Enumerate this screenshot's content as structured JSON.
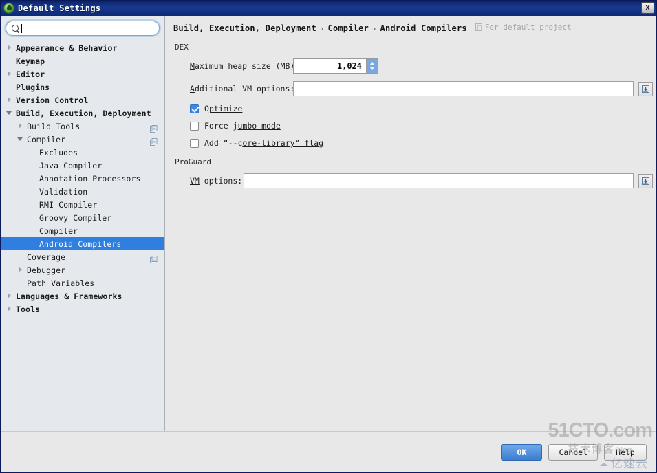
{
  "window": {
    "title": "Default Settings",
    "close_label": "x",
    "app_icon": "android-studio-icon"
  },
  "sidebar": {
    "search": {
      "value": "",
      "placeholder": "",
      "icon": "search-icon"
    },
    "items": [
      {
        "label": "Appearance & Behavior",
        "level": 0,
        "bold": true,
        "twisty": "right",
        "selected": false,
        "config_icon": false
      },
      {
        "label": "Keymap",
        "level": 0,
        "bold": true,
        "twisty": "none",
        "selected": false,
        "config_icon": false
      },
      {
        "label": "Editor",
        "level": 0,
        "bold": true,
        "twisty": "right",
        "selected": false,
        "config_icon": false
      },
      {
        "label": "Plugins",
        "level": 0,
        "bold": true,
        "twisty": "none",
        "selected": false,
        "config_icon": false
      },
      {
        "label": "Version Control",
        "level": 0,
        "bold": true,
        "twisty": "right",
        "selected": false,
        "config_icon": false
      },
      {
        "label": "Build, Execution, Deployment",
        "level": 0,
        "bold": true,
        "twisty": "down",
        "selected": false,
        "config_icon": false
      },
      {
        "label": "Build Tools",
        "level": 1,
        "bold": false,
        "twisty": "right",
        "selected": false,
        "config_icon": true
      },
      {
        "label": "Compiler",
        "level": 1,
        "bold": false,
        "twisty": "down",
        "selected": false,
        "config_icon": true
      },
      {
        "label": "Excludes",
        "level": 2,
        "bold": false,
        "twisty": "none",
        "selected": false,
        "config_icon": false
      },
      {
        "label": "Java Compiler",
        "level": 2,
        "bold": false,
        "twisty": "none",
        "selected": false,
        "config_icon": false
      },
      {
        "label": "Annotation Processors",
        "level": 2,
        "bold": false,
        "twisty": "none",
        "selected": false,
        "config_icon": false
      },
      {
        "label": "Validation",
        "level": 2,
        "bold": false,
        "twisty": "none",
        "selected": false,
        "config_icon": false
      },
      {
        "label": "RMI Compiler",
        "level": 2,
        "bold": false,
        "twisty": "none",
        "selected": false,
        "config_icon": false
      },
      {
        "label": "Groovy Compiler",
        "level": 2,
        "bold": false,
        "twisty": "none",
        "selected": false,
        "config_icon": false
      },
      {
        "label": "Compiler",
        "level": 2,
        "bold": false,
        "twisty": "none",
        "selected": false,
        "config_icon": false
      },
      {
        "label": "Android Compilers",
        "level": 2,
        "bold": false,
        "twisty": "none",
        "selected": true,
        "config_icon": false
      },
      {
        "label": "Coverage",
        "level": 1,
        "bold": false,
        "twisty": "none",
        "selected": false,
        "config_icon": true
      },
      {
        "label": "Debugger",
        "level": 1,
        "bold": false,
        "twisty": "right",
        "selected": false,
        "config_icon": false
      },
      {
        "label": "Path Variables",
        "level": 1,
        "bold": false,
        "twisty": "none",
        "selected": false,
        "config_icon": false
      },
      {
        "label": "Languages & Frameworks",
        "level": 0,
        "bold": true,
        "twisty": "right",
        "selected": false,
        "config_icon": false
      },
      {
        "label": "Tools",
        "level": 0,
        "bold": true,
        "twisty": "right",
        "selected": false,
        "config_icon": false
      }
    ]
  },
  "breadcrumb": {
    "crumbs": [
      "Build, Execution, Deployment",
      "Compiler",
      "Android Compilers"
    ],
    "separator": "›",
    "scope_label": "For default project",
    "scope_icon": "project-scope-icon"
  },
  "dex_section": {
    "title": "DEX",
    "heap_size": {
      "label_prefix": "M",
      "label_rest": "aximum heap size (MB):",
      "value": "1,024",
      "spinner_up_icon": "caret-up-icon",
      "spinner_down_icon": "caret-down-icon"
    },
    "vm_options": {
      "label_prefix": "A",
      "label_rest": "dditional VM options:",
      "value": "",
      "expand_icon": "expand-field-icon"
    },
    "checkboxes": [
      {
        "label_pre": "O",
        "label_post": "ptimize",
        "checked": true,
        "name": "optimize"
      },
      {
        "label_pre": "Force j",
        "label_post": "umbo mode",
        "checked": false,
        "name": "force-jumbo-mode"
      },
      {
        "label_pre": "Add “--c",
        "label_post": "ore-library” flag",
        "checked": false,
        "name": "add-core-library-flag"
      }
    ]
  },
  "proguard_section": {
    "title": "ProGuard",
    "vm_options": {
      "label_prefix": "VM",
      "label_rest": " options:",
      "value": "",
      "expand_icon": "expand-field-icon"
    }
  },
  "footer": {
    "ok_label": "OK",
    "cancel_label": "Cancel",
    "help_label": "Help"
  },
  "watermarks": {
    "site_main": "51CTO.com",
    "site_sub_cn": "技术博客",
    "site_sub_lat": "Blog",
    "cloud_name": "亿速云",
    "cloud_icon": "cloud-icon"
  },
  "colors": {
    "title_bar": "#0a246a",
    "selection": "#2f7fe0",
    "primary_button": "#3a7ed0",
    "checkbox_checked": "#3c87e8",
    "spinner": "#7aa7dc",
    "sidebar_bg": "#e5e9ed",
    "panel_bg": "#e8e8e8"
  }
}
